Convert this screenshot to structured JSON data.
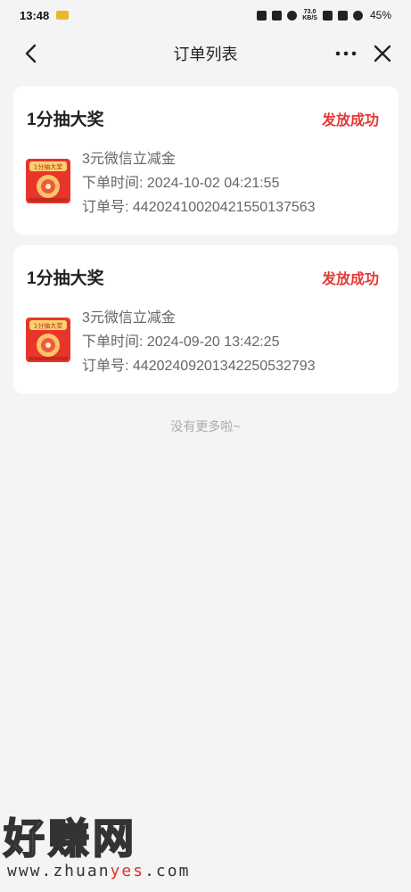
{
  "status_bar": {
    "time": "13:48",
    "net_speed_value": "73.0",
    "net_speed_unit": "KB/S",
    "battery": "45%"
  },
  "nav": {
    "title": "订单列表"
  },
  "orders": [
    {
      "title": "1分抽大奖",
      "status": "发放成功",
      "thumb_text": "1分抽大奖",
      "product": "3元微信立减金",
      "time_label": "下单时间: ",
      "time": "2024-10-02 04:21:55",
      "no_label": "订单号: ",
      "no": "442024100204215501375​63"
    },
    {
      "title": "1分抽大奖",
      "status": "发放成功",
      "thumb_text": "1分抽大奖",
      "product": "3元微信立减金",
      "time_label": "下单时间: ",
      "time": "2024-09-20 13:42:25",
      "no_label": "订单号: ",
      "no": "442024092013422505327​93"
    }
  ],
  "footer": {
    "no_more": "没有更多啦~"
  },
  "watermark": {
    "logo": "好赚网",
    "url_before": "www.zhuan",
    "url_accent": "yes",
    "url_after": ".com"
  },
  "colors": {
    "status": "#e53935",
    "thumb_bg": "#e8352b",
    "background": "#f4f4f4"
  }
}
